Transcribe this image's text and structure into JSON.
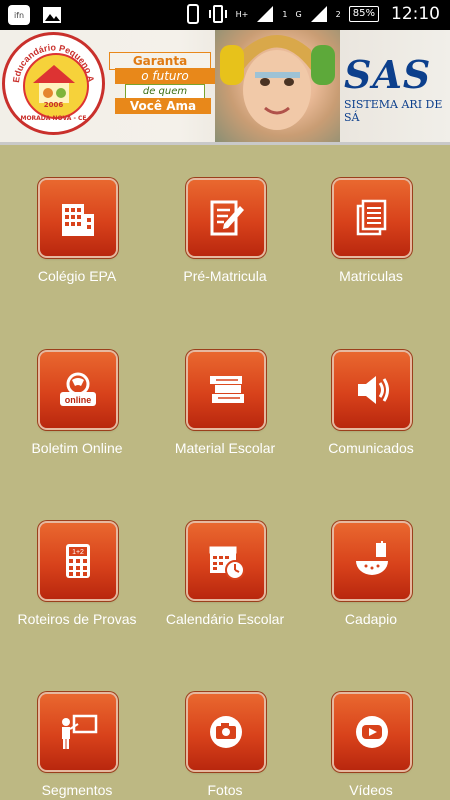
{
  "status_bar": {
    "app_icon": "ifn-app-icon",
    "gallery_icon": "image-icon",
    "signal_left": "H+",
    "signal_right": "G",
    "sim1": "1",
    "sim2": "2",
    "battery": "85%",
    "time": "12:10"
  },
  "banner": {
    "logo_ring_text": "Educandário Pequeno Aprendiz",
    "logo_year": "2006",
    "logo_city": "MORADA NOVA - CE",
    "slogan": [
      "Garanta",
      "o futuro",
      "de quem",
      "Você Ama"
    ],
    "brand_mark": "SAS",
    "brand_name": "SISTEMA ARI DE SÁ"
  },
  "menu": [
    {
      "label": "Colégio EPA",
      "icon": "building-icon"
    },
    {
      "label": "Pré-Matricula",
      "icon": "form-edit-icon"
    },
    {
      "label": "Matriculas",
      "icon": "documents-icon"
    },
    {
      "label": "Boletim Online",
      "icon": "online-report-icon"
    },
    {
      "label": "Material Escolar",
      "icon": "books-icon"
    },
    {
      "label": "Comunicados",
      "icon": "speaker-icon"
    },
    {
      "label": "Roteiros de Provas",
      "icon": "calculator-icon"
    },
    {
      "label": "Calendário Escolar",
      "icon": "calendar-clock-icon"
    },
    {
      "label": "Cadapio",
      "icon": "watermelon-drink-icon"
    },
    {
      "label": "Segmentos",
      "icon": "teacher-board-icon"
    },
    {
      "label": "Fotos",
      "icon": "camera-icon"
    },
    {
      "label": "Vídeos",
      "icon": "play-video-icon"
    }
  ]
}
